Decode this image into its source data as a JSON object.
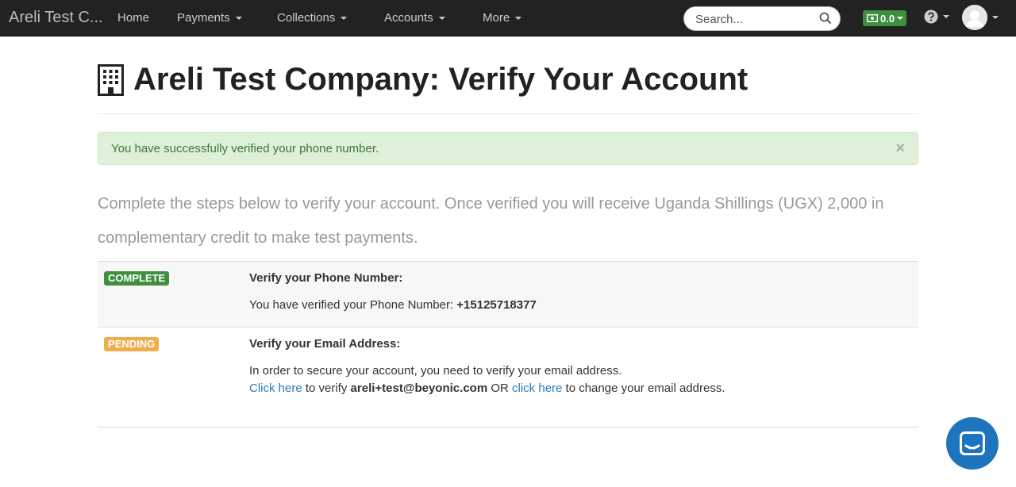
{
  "navbar": {
    "brand": "Areli Test C...",
    "items": [
      {
        "label": "Home"
      },
      {
        "label": "Payments"
      },
      {
        "label": "Collections"
      },
      {
        "label": "Accounts"
      },
      {
        "label": "More"
      }
    ],
    "search_placeholder": "Search...",
    "balance": "0.0"
  },
  "page": {
    "title": "Areli Test Company: Verify Your Account"
  },
  "alert": {
    "message": "You have successfully verified your phone number.",
    "close": "×"
  },
  "intro": "Complete the steps below to verify your account. Once verified you will receive Uganda Shillings (UGX) 2,000 in complementary credit to make test payments.",
  "steps": [
    {
      "status": "COMPLETE",
      "title": "Verify your Phone Number:",
      "text_prefix": "You have verified your Phone Number: ",
      "phone": "+15125718377"
    },
    {
      "status": "PENDING",
      "title": "Verify your Email Address:",
      "line1": "In order to secure your account, you need to verify your email address.",
      "link1": "Click here",
      "mid1": " to verify ",
      "email": "areli+test@beyonic.com",
      "mid2": " OR ",
      "link2": "click here",
      "end": " to change your email address."
    }
  ],
  "colors": {
    "navbar": "#222222",
    "success_label": "#3e8f3e",
    "pending_label": "#f0ad4e",
    "link": "#2a7ab9",
    "chat_button": "#1f75bd"
  }
}
